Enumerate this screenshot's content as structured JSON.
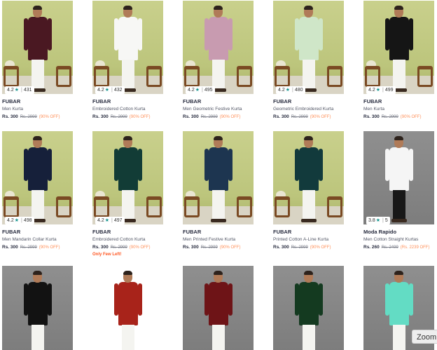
{
  "products": [
    {
      "brand": "FUBAR",
      "title": "Men Kurta",
      "price": "Rs. 300",
      "mrp": "Rs. 2999",
      "discount": "(90% OFF)",
      "rating": "4.2",
      "rating_count": "431",
      "urgency": "",
      "bg": "green",
      "kurta_color": "#4a1822",
      "legs": "light"
    },
    {
      "brand": "FUBAR",
      "title": "Embroidered Cotton Kurta",
      "price": "Rs. 300",
      "mrp": "Rs. 2999",
      "discount": "(90% OFF)",
      "rating": "4.2",
      "rating_count": "432",
      "urgency": "",
      "bg": "green",
      "kurta_color": "#f7f7f5",
      "legs": "light"
    },
    {
      "brand": "FUBAR",
      "title": "Men Geometric Festive Kurta",
      "price": "Rs. 300",
      "mrp": "Rs. 2999",
      "discount": "(90% OFF)",
      "rating": "4.2",
      "rating_count": "495",
      "urgency": "",
      "bg": "green",
      "kurta_color": "#c89bb0",
      "legs": "light"
    },
    {
      "brand": "FUBAR",
      "title": "Geometric Embroidered Kurta",
      "price": "Rs. 300",
      "mrp": "Rs. 2999",
      "discount": "(90% OFF)",
      "rating": "4.2",
      "rating_count": "480",
      "urgency": "",
      "bg": "green",
      "kurta_color": "#cfe6c8",
      "legs": "light"
    },
    {
      "brand": "FUBAR",
      "title": "Men Kurta",
      "price": "Rs. 300",
      "mrp": "Rs. 2999",
      "discount": "(90% OFF)",
      "rating": "4.2",
      "rating_count": "499",
      "urgency": "",
      "bg": "green",
      "kurta_color": "#151515",
      "legs": "light"
    },
    {
      "brand": "FUBAR",
      "title": "Men Mandarin Collar Kurta",
      "price": "Rs. 300",
      "mrp": "Rs. 2999",
      "discount": "(90% OFF)",
      "rating": "4.2",
      "rating_count": "498",
      "urgency": "",
      "bg": "green",
      "kurta_color": "#16203a",
      "legs": "light"
    },
    {
      "brand": "FUBAR",
      "title": "Embroidered Cotton Kurta",
      "price": "Rs. 300",
      "mrp": "Rs. 2999",
      "discount": "(90% OFF)",
      "rating": "4.2",
      "rating_count": "497",
      "urgency": "Only Few Left!",
      "bg": "green",
      "kurta_color": "#123c36",
      "legs": "light"
    },
    {
      "brand": "FUBAR",
      "title": "Men Printed Festive Kurta",
      "price": "Rs. 300",
      "mrp": "Rs. 2999",
      "discount": "(90% OFF)",
      "rating": "",
      "rating_count": "",
      "urgency": "",
      "bg": "green",
      "kurta_color": "#1d3550",
      "legs": "light"
    },
    {
      "brand": "FUBAR",
      "title": "Printed Cotton A-Line Kurta",
      "price": "Rs. 300",
      "mrp": "Rs. 2999",
      "discount": "(90% OFF)",
      "rating": "",
      "rating_count": "",
      "urgency": "",
      "bg": "green",
      "kurta_color": "#123a3c",
      "legs": "light"
    },
    {
      "brand": "Moda Rapido",
      "title": "Men Cotton Straight Kurtas",
      "price": "Rs. 260",
      "mrp": "Rs. 2499",
      "discount": "(Rs. 2239 OFF)",
      "rating": "3.8",
      "rating_count": "5",
      "urgency": "",
      "bg": "gray",
      "kurta_color": "#f5f5f5",
      "legs": "dark"
    },
    {
      "brand": "",
      "title": "",
      "price": "",
      "mrp": "",
      "discount": "",
      "rating": "",
      "rating_count": "",
      "urgency": "",
      "bg": "gray",
      "kurta_color": "#121212",
      "legs": "light"
    },
    {
      "brand": "",
      "title": "",
      "price": "",
      "mrp": "",
      "discount": "",
      "rating": "",
      "rating_count": "",
      "urgency": "",
      "bg": "white",
      "kurta_color": "#a8231a",
      "legs": "light"
    },
    {
      "brand": "",
      "title": "",
      "price": "",
      "mrp": "",
      "discount": "",
      "rating": "",
      "rating_count": "",
      "urgency": "",
      "bg": "gray",
      "kurta_color": "#6e1417",
      "legs": "light"
    },
    {
      "brand": "",
      "title": "",
      "price": "",
      "mrp": "",
      "discount": "",
      "rating": "",
      "rating_count": "",
      "urgency": "",
      "bg": "gray",
      "kurta_color": "#143a20",
      "legs": "light"
    },
    {
      "brand": "",
      "title": "",
      "price": "",
      "mrp": "",
      "discount": "",
      "rating": "",
      "rating_count": "",
      "urgency": "",
      "bg": "gray",
      "kurta_color": "#63dcc4",
      "legs": "light"
    }
  ],
  "zoom_button": {
    "label": "Zoom V"
  },
  "colors": {
    "accent_discount": "#ff905a",
    "rating_star": "#14958f",
    "urgency": "#ff5722"
  }
}
